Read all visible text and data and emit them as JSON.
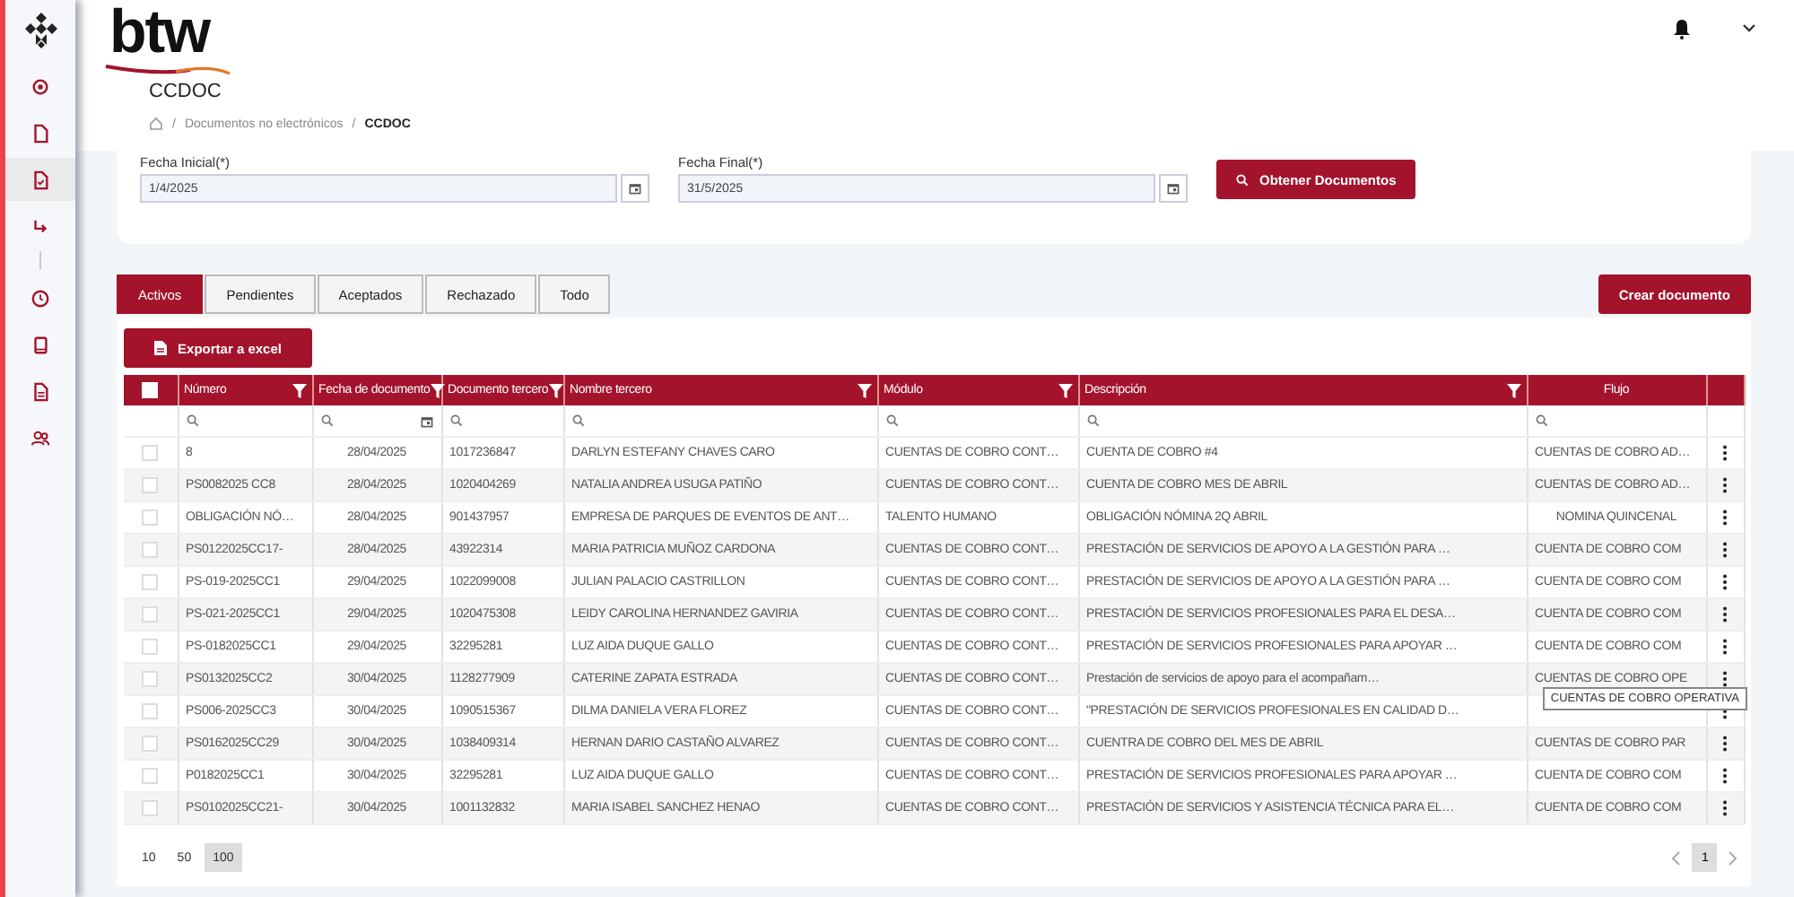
{
  "sidebar": {
    "items": [
      {
        "kind": "gear",
        "selected": false
      },
      {
        "kind": "doc",
        "selected": false
      },
      {
        "kind": "doc-check",
        "selected": true
      },
      {
        "kind": "arrow",
        "selected": false
      },
      {
        "kind": "clock",
        "selected": false
      },
      {
        "kind": "book",
        "selected": false
      },
      {
        "kind": "doc-lines",
        "selected": false
      },
      {
        "kind": "users",
        "selected": false
      }
    ]
  },
  "header": {
    "logo": "btw"
  },
  "page": {
    "title": "CCDOC",
    "breadcrumb": [
      {
        "separator": "/",
        "label": "Documentos no electrónicos"
      },
      {
        "separator": "/",
        "label": "CCDOC"
      }
    ]
  },
  "filters": {
    "fields": [
      {
        "label": "Fecha Inicial(*)",
        "value": "1/4/2025"
      },
      {
        "label": "Fecha Final(*)",
        "value": "31/5/2025"
      }
    ],
    "button": "Obtener Documentos"
  },
  "tabs": [
    {
      "label": "Activos",
      "selected": true
    },
    {
      "label": "Pendientes",
      "selected": false
    },
    {
      "label": "Aceptados",
      "selected": false
    },
    {
      "label": "Rechazado",
      "selected": false
    },
    {
      "label": "Todo",
      "selected": false
    }
  ],
  "create_button": "Crear documento",
  "export_button": "Exportar a excel",
  "table": {
    "select_all": {
      "checked": false
    },
    "columns": [
      {
        "label": "Número",
        "kind": "text"
      },
      {
        "label": "Fecha de documento",
        "kind": "date"
      },
      {
        "label": "Documento tercero",
        "kind": "text"
      },
      {
        "label": "Nombre tercero",
        "kind": "text"
      },
      {
        "label": "Módulo",
        "kind": "text"
      },
      {
        "label": "Descripción",
        "kind": "text"
      },
      {
        "label": "Flujo",
        "kind": "text"
      }
    ],
    "rows": [
      {
        "checked": false,
        "cells": [
          "8",
          "28/04/2025",
          "1017236847",
          "DARLYN ESTEFANY CHAVES CARO",
          "CUENTAS DE COBRO CONT…",
          "CUENTA DE COBRO #4",
          "CUENTAS DE COBRO AD…"
        ]
      },
      {
        "checked": false,
        "cells": [
          "PS0082025 CC8",
          "28/04/2025",
          "1020404269",
          "NATALIA ANDREA USUGA PATIÑO",
          "CUENTAS DE COBRO CONT…",
          "CUENTA DE COBRO MES DE ABRIL",
          "CUENTAS DE COBRO AD…"
        ]
      },
      {
        "checked": false,
        "cells": [
          "OBLIGACIÓN NÓ…",
          "28/04/2025",
          "901437957",
          "EMPRESA DE PARQUES DE EVENTOS DE ANT…",
          "TALENTO HUMANO",
          "OBLIGACIÓN NÓMINA 2Q ABRIL",
          "NOMINA QUINCENAL"
        ]
      },
      {
        "checked": false,
        "cells": [
          "PS0122025CC17-",
          "28/04/2025",
          "43922314",
          "MARIA PATRICIA MUÑOZ CARDONA",
          "CUENTAS DE COBRO CONT…",
          "PRESTACIÓN DE SERVICIOS DE APOYO A LA GESTIÓN PARA …",
          "CUENTA DE COBRO COM"
        ]
      },
      {
        "checked": false,
        "cells": [
          "PS-019-2025CC1",
          "29/04/2025",
          "1022099008",
          "JULIAN PALACIO CASTRILLON",
          "CUENTAS DE COBRO CONT…",
          "PRESTACIÓN DE SERVICIOS DE APOYO A LA GESTIÓN PARA …",
          "CUENTA DE COBRO COM"
        ]
      },
      {
        "checked": false,
        "cells": [
          "PS-021-2025CC1",
          "29/04/2025",
          "1020475308",
          "LEIDY CAROLINA HERNANDEZ GAVIRIA",
          "CUENTAS DE COBRO CONT…",
          "PRESTACIÓN DE SERVICIOS PROFESIONALES PARA EL DESA…",
          "CUENTA DE COBRO COM"
        ]
      },
      {
        "checked": false,
        "cells": [
          "PS-0182025CC1",
          "29/04/2025",
          "32295281",
          "LUZ AIDA DUQUE GALLO",
          "CUENTAS DE COBRO CONT…",
          "PRESTACIÓN DE SERVICIOS PROFESIONALES PARA APOYAR …",
          "CUENTA DE COBRO COM"
        ]
      },
      {
        "checked": false,
        "cells": [
          "PS0132025CC2",
          "30/04/2025",
          "1128277909",
          "CATERINE ZAPATA ESTRADA",
          "CUENTAS DE COBRO CONT…",
          "Prestación de servicios de apoyo para el acompañam…",
          "CUENTAS DE COBRO OPE"
        ],
        "tooltip": "CUENTAS DE COBRO OPERATIVA"
      },
      {
        "checked": false,
        "cells": [
          "PS006-2025CC3",
          "30/04/2025",
          "1090515367",
          "DILMA DANIELA VERA FLOREZ",
          "CUENTAS DE COBRO CONT…",
          "\"PRESTACIÓN DE SERVICIOS PROFESIONALES EN CALIDAD D…"
        ]
      },
      {
        "checked": false,
        "cells": [
          "PS0162025CC29",
          "30/04/2025",
          "1038409314",
          "HERNAN DARIO CASTAÑO ALVAREZ",
          "CUENTAS DE COBRO CONT…",
          "CUENTRA DE COBRO DEL MES DE ABRIL",
          "CUENTAS DE COBRO PAR"
        ]
      },
      {
        "checked": false,
        "cells": [
          "P0182025CC1",
          "30/04/2025",
          "32295281",
          "LUZ AIDA DUQUE GALLO",
          "CUENTAS DE COBRO CONT…",
          "PRESTACIÓN DE SERVICIOS PROFESIONALES PARA APOYAR …",
          "CUENTA DE COBRO COM"
        ]
      },
      {
        "checked": false,
        "cells": [
          "PS0102025CC21-",
          "30/04/2025",
          "1001132832",
          "MARIA ISABEL SANCHEZ HENAO",
          "CUENTAS DE COBRO CONT…",
          "PRESTACIÓN DE SERVICIOS Y ASISTENCIA TÉCNICA PARA EL…",
          "CUENTA DE COBRO COM"
        ]
      }
    ]
  },
  "pagination": {
    "page_sizes": [
      {
        "label": "10",
        "selected": false
      },
      {
        "label": "50",
        "selected": false
      },
      {
        "label": "100",
        "selected": true
      }
    ],
    "pages": [
      {
        "label": "1",
        "selected": true
      }
    ]
  }
}
